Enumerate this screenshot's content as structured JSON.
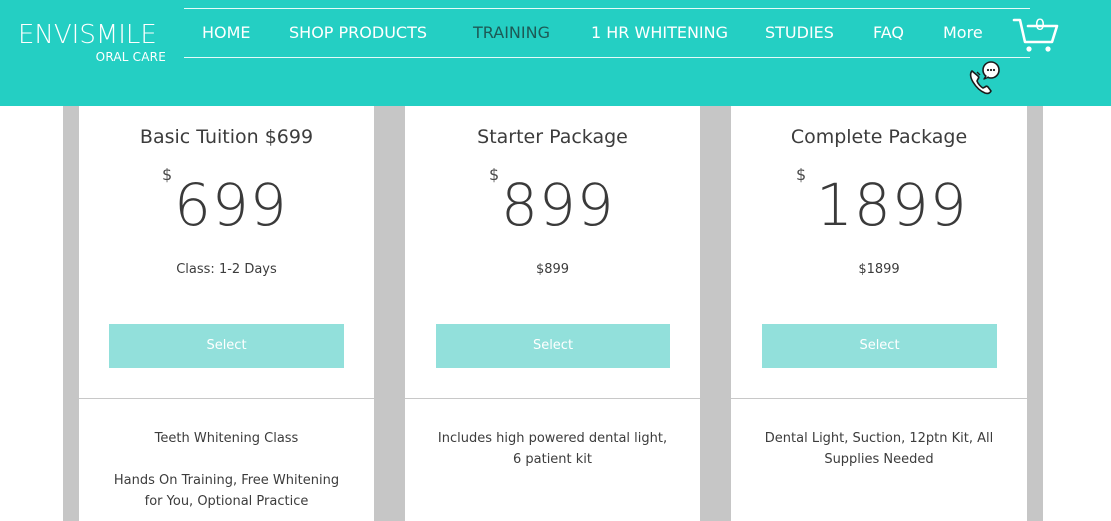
{
  "header": {
    "logo": {
      "name": "ENVISMILE",
      "sub": "ORAL CARE"
    },
    "nav": [
      {
        "label": "HOME",
        "active": false
      },
      {
        "label": "SHOP PRODUCTS",
        "active": false
      },
      {
        "label": "TRAINING",
        "active": true
      },
      {
        "label": "1 HR WHITENING",
        "active": false
      },
      {
        "label": "STUDIES",
        "active": false
      },
      {
        "label": "FAQ",
        "active": false
      },
      {
        "label": "More",
        "active": false
      }
    ],
    "cart_count": "0",
    "cart_icon": "cart-icon",
    "chat_icon": "phone-chat-icon"
  },
  "colors": {
    "header_bg": "#24cfc3",
    "nav_active": "#1d5a56",
    "button_bg": "#92e0db",
    "side_stripe": "#c6c6c6"
  },
  "plans": [
    {
      "title": "Basic Tuition $699",
      "currency": "$",
      "price": "699",
      "subtitle": "Class: 1-2 Days",
      "button": "Select",
      "description": [
        "Teeth Whitening Class",
        "Hands On Training, Free Whitening for You, Optional Practice"
      ]
    },
    {
      "title": "Starter Package",
      "currency": "$",
      "price": "899",
      "subtitle": "$899",
      "button": "Select",
      "description": [
        "Includes high powered dental light, 6 patient kit"
      ]
    },
    {
      "title": "Complete Package",
      "currency": "$",
      "price": "1899",
      "subtitle": "$1899",
      "button": "Select",
      "description": [
        "Dental Light, Suction, 12ptn Kit, All Supplies Needed"
      ]
    }
  ]
}
